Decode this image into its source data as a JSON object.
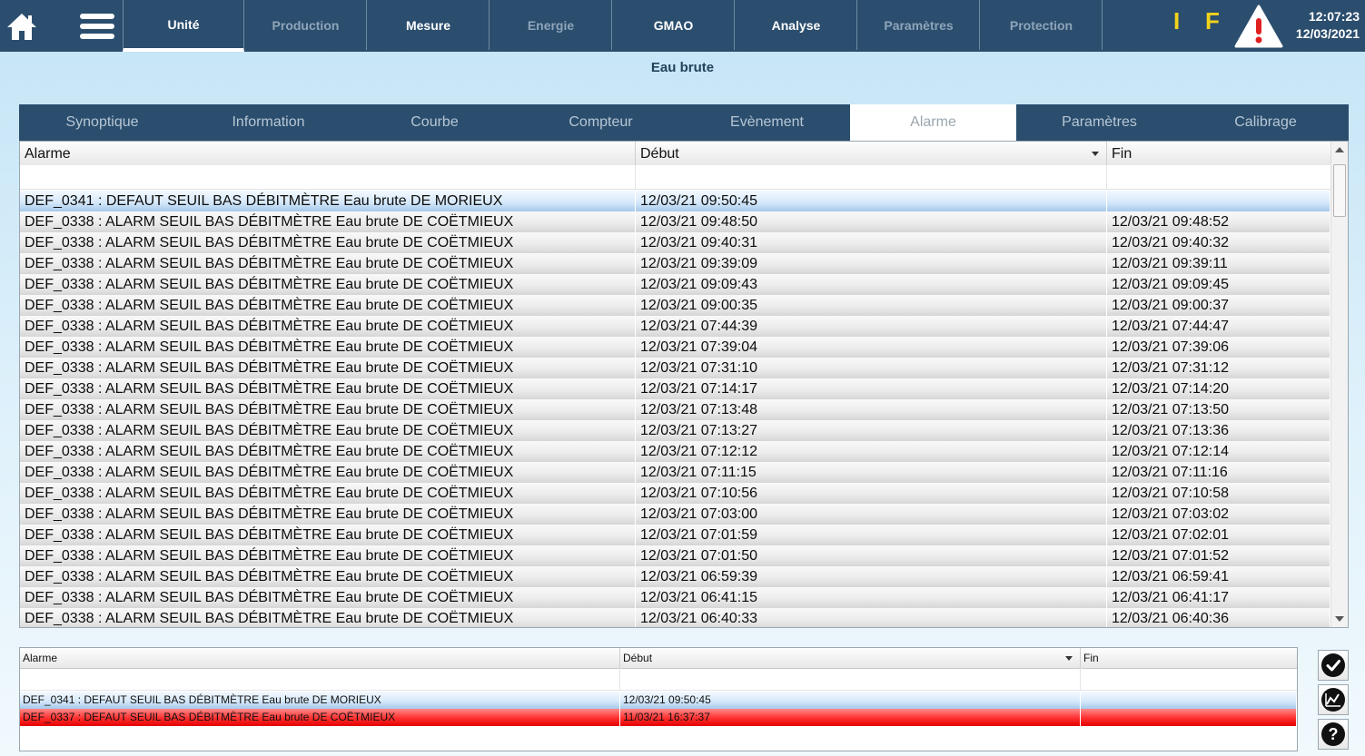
{
  "nav": {
    "tabs": [
      {
        "label": "Unité",
        "state": "active"
      },
      {
        "label": "Production",
        "state": "disabled"
      },
      {
        "label": "Mesure",
        "state": "normal"
      },
      {
        "label": "Energie",
        "state": "disabled"
      },
      {
        "label": "GMAO",
        "state": "normal"
      },
      {
        "label": "Analyse",
        "state": "normal"
      },
      {
        "label": "Paramètres",
        "state": "disabled"
      },
      {
        "label": "Protection",
        "state": "disabled"
      }
    ],
    "indicator_i": "I",
    "indicator_f": "F",
    "time": "12:07:23",
    "date": "12/03/2021",
    "icons": {
      "home": "home-icon",
      "menu": "hamburger-menu-icon",
      "alert": "warning-triangle-icon"
    }
  },
  "page": {
    "title": "Eau brute"
  },
  "subtabs": [
    {
      "label": "Synoptique",
      "active": false
    },
    {
      "label": "Information",
      "active": false
    },
    {
      "label": "Courbe",
      "active": false
    },
    {
      "label": "Compteur",
      "active": false
    },
    {
      "label": "Evènement",
      "active": false
    },
    {
      "label": "Alarme",
      "active": true
    },
    {
      "label": "Paramètres",
      "active": false
    },
    {
      "label": "Calibrage",
      "active": false
    }
  ],
  "alarm_table": {
    "columns": [
      "Alarme",
      "Début",
      "Fin"
    ],
    "rows": [
      {
        "alarme": "DEF_0341 : DEFAUT SEUIL BAS DÉBITMÈTRE Eau brute DE MORIEUX",
        "debut": "12/03/21 09:50:45",
        "fin": "",
        "selected": true
      },
      {
        "alarme": "DEF_0338 : ALARM SEUIL BAS DÉBITMÈTRE Eau brute DE COËTMIEUX",
        "debut": "12/03/21 09:48:50",
        "fin": "12/03/21 09:48:52"
      },
      {
        "alarme": "DEF_0338 : ALARM SEUIL BAS DÉBITMÈTRE Eau brute DE COËTMIEUX",
        "debut": "12/03/21 09:40:31",
        "fin": "12/03/21 09:40:32"
      },
      {
        "alarme": "DEF_0338 : ALARM SEUIL BAS DÉBITMÈTRE Eau brute DE COËTMIEUX",
        "debut": "12/03/21 09:39:09",
        "fin": "12/03/21 09:39:11"
      },
      {
        "alarme": "DEF_0338 : ALARM SEUIL BAS DÉBITMÈTRE Eau brute DE COËTMIEUX",
        "debut": "12/03/21 09:09:43",
        "fin": "12/03/21 09:09:45"
      },
      {
        "alarme": "DEF_0338 : ALARM SEUIL BAS DÉBITMÈTRE Eau brute DE COËTMIEUX",
        "debut": "12/03/21 09:00:35",
        "fin": "12/03/21 09:00:37"
      },
      {
        "alarme": "DEF_0338 : ALARM SEUIL BAS DÉBITMÈTRE Eau brute DE COËTMIEUX",
        "debut": "12/03/21 07:44:39",
        "fin": "12/03/21 07:44:47"
      },
      {
        "alarme": "DEF_0338 : ALARM SEUIL BAS DÉBITMÈTRE Eau brute DE COËTMIEUX",
        "debut": "12/03/21 07:39:04",
        "fin": "12/03/21 07:39:06"
      },
      {
        "alarme": "DEF_0338 : ALARM SEUIL BAS DÉBITMÈTRE Eau brute DE COËTMIEUX",
        "debut": "12/03/21 07:31:10",
        "fin": "12/03/21 07:31:12"
      },
      {
        "alarme": "DEF_0338 : ALARM SEUIL BAS DÉBITMÈTRE Eau brute DE COËTMIEUX",
        "debut": "12/03/21 07:14:17",
        "fin": "12/03/21 07:14:20"
      },
      {
        "alarme": "DEF_0338 : ALARM SEUIL BAS DÉBITMÈTRE Eau brute DE COËTMIEUX",
        "debut": "12/03/21 07:13:48",
        "fin": "12/03/21 07:13:50"
      },
      {
        "alarme": "DEF_0338 : ALARM SEUIL BAS DÉBITMÈTRE Eau brute DE COËTMIEUX",
        "debut": "12/03/21 07:13:27",
        "fin": "12/03/21 07:13:36"
      },
      {
        "alarme": "DEF_0338 : ALARM SEUIL BAS DÉBITMÈTRE Eau brute DE COËTMIEUX",
        "debut": "12/03/21 07:12:12",
        "fin": "12/03/21 07:12:14"
      },
      {
        "alarme": "DEF_0338 : ALARM SEUIL BAS DÉBITMÈTRE Eau brute DE COËTMIEUX",
        "debut": "12/03/21 07:11:15",
        "fin": "12/03/21 07:11:16"
      },
      {
        "alarme": "DEF_0338 : ALARM SEUIL BAS DÉBITMÈTRE Eau brute DE COËTMIEUX",
        "debut": "12/03/21 07:10:56",
        "fin": "12/03/21 07:10:58"
      },
      {
        "alarme": "DEF_0338 : ALARM SEUIL BAS DÉBITMÈTRE Eau brute DE COËTMIEUX",
        "debut": "12/03/21 07:03:00",
        "fin": "12/03/21 07:03:02"
      },
      {
        "alarme": "DEF_0338 : ALARM SEUIL BAS DÉBITMÈTRE Eau brute DE COËTMIEUX",
        "debut": "12/03/21 07:01:59",
        "fin": "12/03/21 07:02:01"
      },
      {
        "alarme": "DEF_0338 : ALARM SEUIL BAS DÉBITMÈTRE Eau brute DE COËTMIEUX",
        "debut": "12/03/21 07:01:50",
        "fin": "12/03/21 07:01:52"
      },
      {
        "alarme": "DEF_0338 : ALARM SEUIL BAS DÉBITMÈTRE Eau brute DE COËTMIEUX",
        "debut": "12/03/21 06:59:39",
        "fin": "12/03/21 06:59:41"
      },
      {
        "alarme": "DEF_0338 : ALARM SEUIL BAS DÉBITMÈTRE Eau brute DE COËTMIEUX",
        "debut": "12/03/21 06:41:15",
        "fin": "12/03/21 06:41:17"
      },
      {
        "alarme": "DEF_0338 : ALARM SEUIL BAS DÉBITMÈTRE Eau brute DE COËTMIEUX",
        "debut": "12/03/21 06:40:33",
        "fin": "12/03/21 06:40:36"
      }
    ]
  },
  "active_alarms": {
    "columns": [
      "Alarme",
      "Début",
      "Fin"
    ],
    "rows": [
      {
        "alarme": "DEF_0341 : DEFAUT SEUIL BAS DÉBITMÈTRE Eau brute DE MORIEUX",
        "debut": "12/03/21 09:50:45",
        "fin": "",
        "style": "blue"
      },
      {
        "alarme": "DEF_0337 : DEFAUT SEUIL BAS DÉBITMÈTRE Eau brute DE COËTMIEUX",
        "debut": "11/03/21 16:37:37",
        "fin": "",
        "style": "red"
      }
    ]
  },
  "side_buttons": [
    "acknowledge-check-icon",
    "trend-chart-icon",
    "help-question-icon"
  ],
  "colors": {
    "navbar": "#2b4e6e",
    "indicator": "#f3d31b",
    "alert_red": "#e02020",
    "active_alarm_red": "#ff2f2f",
    "selected_blue": "#a6c9ec"
  }
}
